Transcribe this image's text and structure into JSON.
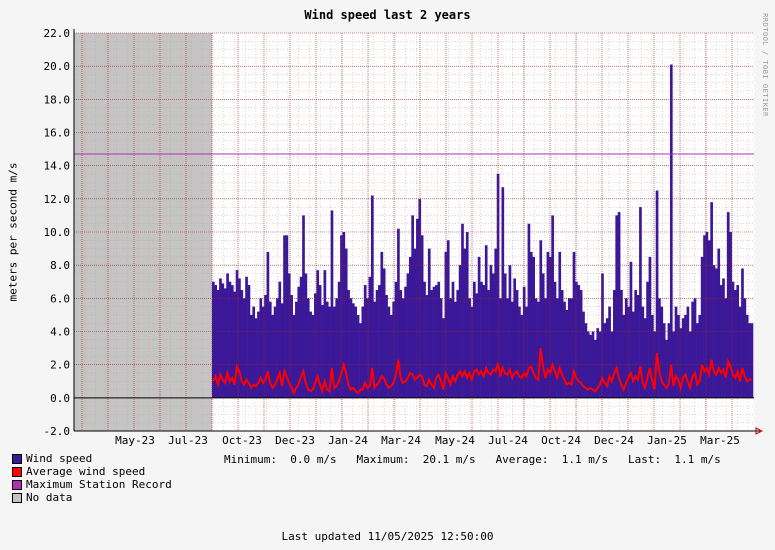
{
  "chart_data": {
    "type": "bar",
    "title": "Wind speed last 2 years",
    "ylabel": "meters per second   m/s",
    "watermark": "RRDTOOL / TOBI OETIKER",
    "ylim": [
      -2,
      22
    ],
    "y_ticks": [
      "-2.0",
      "0.0",
      "2.0",
      "4.0",
      "6.0",
      "8.0",
      "10.0",
      "12.0",
      "14.0",
      "16.0",
      "18.0",
      "20.0",
      "22.0"
    ],
    "x_ticks": [
      "May-23",
      "Jul-23",
      "Oct-23",
      "Dec-23",
      "Jan-24",
      "Mar-24",
      "May-24",
      "Jul-24",
      "Oct-24",
      "Dec-24",
      "Jan-25",
      "Mar-25"
    ],
    "no_data_until": "Aug-23",
    "maximum_station_record": 14.7,
    "wind_speed_max_values": [
      7.0,
      6.8,
      6.5,
      7.2,
      6.9,
      6.6,
      7.5,
      7.0,
      6.8,
      6.4,
      7.7,
      7.2,
      6.5,
      6.0,
      7.3,
      6.8,
      5.0,
      5.5,
      4.8,
      5.2,
      6.0,
      5.5,
      6.2,
      8.8,
      5.8,
      5.0,
      5.5,
      6.0,
      7.0,
      5.7,
      9.8,
      9.8,
      7.5,
      6.2,
      5.0,
      5.8,
      6.7,
      7.3,
      11.0,
      7.5,
      6.0,
      5.2,
      5.0,
      6.3,
      7.7,
      6.8,
      5.6,
      7.7,
      5.8,
      5.5,
      11.3,
      5.5,
      6.0,
      7.0,
      9.8,
      10.0,
      9.0,
      6.5,
      6.0,
      5.7,
      5.5,
      5.0,
      4.5,
      5.5,
      6.8,
      6.0,
      7.3,
      12.2,
      5.8,
      6.5,
      6.8,
      8.8,
      7.8,
      6.2,
      5.5,
      5.0,
      5.8,
      7.0,
      10.2,
      6.5,
      6.0,
      6.7,
      7.5,
      8.5,
      11.0,
      9.0,
      10.8,
      12.0,
      9.8,
      7.0,
      6.2,
      9.0,
      6.5,
      6.7,
      6.8,
      7.0,
      6.0,
      4.8,
      8.8,
      9.5,
      6.0,
      7.0,
      5.8,
      6.5,
      8.0,
      10.5,
      9.0,
      10.0,
      6.0,
      5.5,
      7.0,
      6.3,
      8.5,
      7.0,
      6.8,
      9.2,
      6.5,
      8.0,
      7.5,
      9.0,
      13.5,
      6.0,
      12.7,
      7.5,
      6.0,
      8.0,
      5.8,
      7.2,
      6.5,
      5.5,
      5.0,
      6.7,
      5.5,
      10.5,
      8.8,
      8.5,
      6.0,
      5.8,
      9.5,
      7.5,
      6.0,
      8.8,
      8.5,
      11.0,
      7.0,
      6.0,
      8.8,
      6.5,
      5.8,
      5.3,
      6.0,
      6.0,
      8.8,
      7.0,
      6.8,
      6.5,
      5.2,
      4.5,
      4.0,
      3.8,
      4.0,
      3.5,
      4.2,
      4.0,
      7.5,
      4.5,
      4.8,
      5.5,
      4.0,
      6.5,
      11.0,
      11.2,
      6.5,
      5.0,
      6.0,
      5.5,
      8.2,
      5.2,
      6.5,
      6.2,
      11.5,
      5.5,
      4.8,
      7.0,
      8.5,
      5.0,
      4.0,
      12.5,
      6.0,
      5.5,
      4.5,
      3.5,
      4.5,
      20.1,
      4.0,
      5.5,
      5.0,
      4.2,
      4.8,
      5.0,
      5.5,
      4.0,
      5.8,
      6.0,
      4.5,
      5.0,
      8.5,
      9.8,
      10.0,
      9.5,
      11.8,
      8.0,
      7.8,
      9.0,
      6.8,
      7.2,
      6.0,
      11.2,
      10.0,
      7.0,
      6.5,
      6.8,
      5.5,
      7.8,
      6.0,
      5.0,
      4.5,
      4.5
    ],
    "average_wind_speed_values": [
      1.0,
      1.3,
      0.8,
      1.4,
      1.1,
      0.9,
      1.5,
      1.0,
      1.2,
      0.8,
      1.9,
      1.6,
      1.0,
      0.8,
      1.1,
      0.9,
      0.6,
      0.8,
      0.7,
      0.9,
      1.2,
      0.9,
      1.1,
      1.6,
      0.9,
      0.6,
      0.8,
      1.1,
      1.5,
      0.7,
      1.6,
      1.3,
      0.9,
      0.6,
      0.3,
      0.6,
      0.8,
      1.3,
      1.6,
      0.9,
      0.5,
      0.4,
      0.5,
      0.9,
      1.3,
      0.8,
      0.4,
      1.0,
      0.5,
      0.4,
      1.8,
      0.6,
      0.7,
      1.0,
      1.5,
      2.0,
      1.5,
      0.8,
      0.5,
      0.6,
      0.4,
      0.3,
      0.5,
      0.5,
      0.9,
      0.6,
      0.7,
      1.8,
      0.6,
      0.8,
      1.0,
      1.3,
      1.2,
      0.8,
      0.6,
      0.7,
      0.9,
      1.4,
      2.3,
      1.2,
      0.9,
      1.0,
      1.2,
      1.5,
      1.4,
      1.1,
      1.2,
      1.4,
      1.3,
      0.8,
      0.7,
      1.1,
      0.8,
      0.6,
      1.2,
      1.4,
      1.0,
      0.5,
      1.5,
      1.2,
      0.8,
      1.3,
      1.0,
      1.4,
      1.6,
      1.3,
      1.6,
      1.2,
      1.5,
      1.1,
      1.6,
      1.7,
      1.4,
      1.6,
      1.3,
      1.8,
      1.5,
      1.4,
      1.7,
      1.6,
      2.1,
      1.3,
      1.8,
      1.5,
      1.4,
      1.7,
      1.2,
      1.5,
      1.6,
      1.3,
      1.2,
      1.5,
      1.3,
      1.8,
      1.9,
      1.5,
      1.2,
      1.1,
      3.0,
      1.9,
      1.2,
      1.7,
      1.5,
      2.0,
      1.6,
      1.2,
      1.8,
      1.4,
      1.1,
      0.8,
      0.9,
      0.8,
      1.6,
      1.2,
      1.0,
      0.9,
      0.7,
      0.6,
      0.5,
      0.6,
      0.5,
      0.4,
      0.6,
      0.8,
      1.2,
      0.9,
      0.7,
      1.3,
      1.0,
      1.5,
      1.8,
      1.2,
      0.8,
      0.5,
      0.9,
      1.2,
      1.5,
      1.0,
      1.3,
      1.1,
      1.9,
      0.9,
      0.6,
      1.2,
      1.8,
      1.0,
      0.5,
      2.7,
      1.6,
      1.0,
      0.8,
      0.6,
      0.8,
      2.0,
      0.7,
      1.3,
      1.1,
      0.6,
      1.2,
      1.4,
      1.0,
      0.6,
      1.3,
      1.5,
      0.8,
      1.0,
      2.0,
      1.6,
      1.8,
      1.4,
      2.3,
      1.6,
      1.4,
      1.8,
      1.5,
      1.7,
      1.2,
      2.2,
      1.9,
      1.4,
      1.2,
      1.6,
      1.0,
      1.8,
      1.3,
      1.0,
      1.1,
      1.1
    ],
    "legend": [
      {
        "label": "Wind speed",
        "color": "#3a1898"
      },
      {
        "label": "Average wind speed",
        "color": "#ff0000"
      },
      {
        "label": "Maximum Station Record",
        "color": "#b030b0"
      },
      {
        "label": "No data",
        "color": "#c4c4c4"
      }
    ],
    "stats": {
      "minimum": "Minimum:  0.0 m/s",
      "maximum": "Maximum:  20.1 m/s",
      "average": "Average:  1.1 m/s",
      "last": "Last:  1.1 m/s"
    },
    "last_updated": "Last updated 11/05/2025 12:50:00"
  }
}
